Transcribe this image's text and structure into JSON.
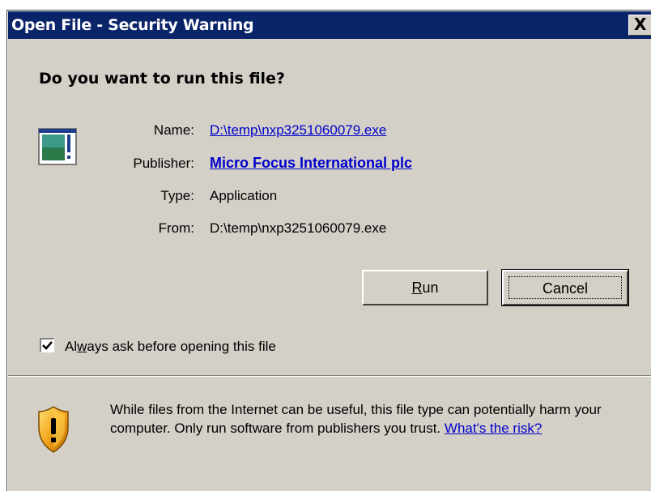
{
  "window": {
    "title": "Open File - Security Warning",
    "close_label": "X"
  },
  "question": "Do you want to run this file?",
  "fields": {
    "name_label": "Name:",
    "name_value": "D:\\temp\\nxp3251060079.exe",
    "publisher_label": "Publisher:",
    "publisher_value": "Micro Focus International plc",
    "type_label": "Type:",
    "type_value": "Application",
    "from_label": "From:",
    "from_value": "D:\\temp\\nxp3251060079.exe"
  },
  "buttons": {
    "run_prefix": "",
    "run_mnemonic": "R",
    "run_rest": "un",
    "cancel": "Cancel"
  },
  "checkbox": {
    "checked": true,
    "label_pre": "Al",
    "label_mnemonic": "w",
    "label_post": "ays ask before opening this file"
  },
  "warning": {
    "text": "While files from the Internet can be useful, this file type can potentially harm your computer. Only run software from publishers you trust.",
    "link": "What's the risk?"
  },
  "colors": {
    "titlebar": "#0a246a",
    "dialog_bg": "#d4d0c8",
    "link": "#0000cc"
  },
  "icons": [
    "application-icon",
    "shield-warning-icon",
    "checkmark-icon",
    "close-icon"
  ]
}
